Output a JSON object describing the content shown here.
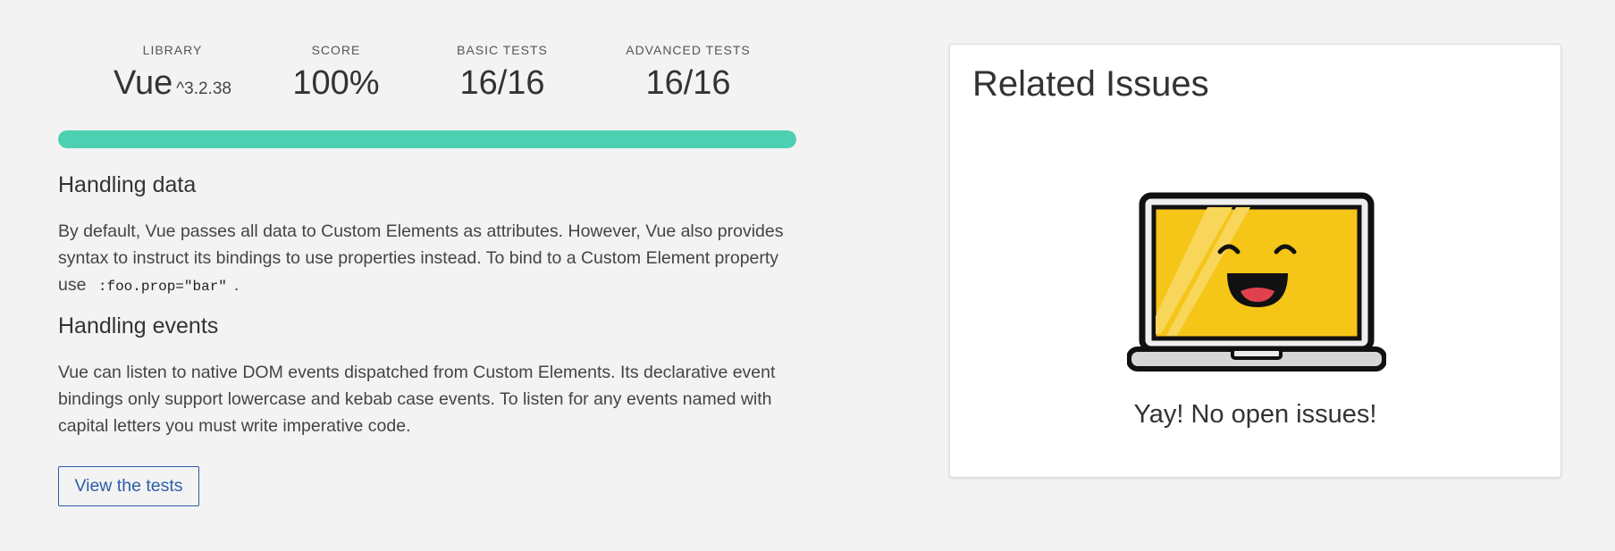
{
  "stats": {
    "library": {
      "label": "LIBRARY",
      "value": "Vue",
      "version": "^3.2.38"
    },
    "score": {
      "label": "SCORE",
      "value": "100%"
    },
    "basic": {
      "label": "BASIC TESTS",
      "value": "16/16"
    },
    "advanced": {
      "label": "ADVANCED TESTS",
      "value": "16/16"
    }
  },
  "progress": {
    "fraction": 1.0,
    "color": "#4dd0b1"
  },
  "handling_data": {
    "title": "Handling data",
    "text": "By default, Vue passes all data to Custom Elements as attributes. However, Vue also provides syntax to instruct its bindings to use properties instead. To bind to a Custom Element property use",
    "code": ":foo.prop=\"bar\"",
    "tail": "."
  },
  "handling_events": {
    "title": "Handling events",
    "text": "Vue can listen to native DOM events dispatched from Custom Elements. Its declarative event bindings only support lowercase and kebab case events. To listen for any events named with capital letters you must write imperative code."
  },
  "tests_button": {
    "label": "View the tests"
  },
  "related_issues": {
    "title": "Related Issues",
    "illustration": "happy-laptop-icon",
    "empty_message": "Yay! No open issues!"
  }
}
